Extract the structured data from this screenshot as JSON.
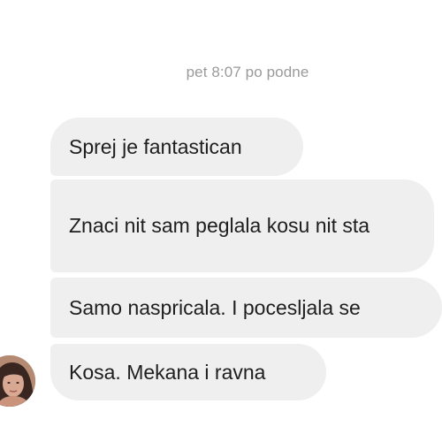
{
  "conversation": {
    "timestamp": "pet 8:07 po podne",
    "messages": [
      {
        "text": "Sprej je fantastican"
      },
      {
        "text": "Znaci nit sam peglala kosu nit sta"
      },
      {
        "text": "Samo naspricala. I pocesljala se"
      },
      {
        "text": "Kosa. Mekana i ravna"
      }
    ]
  },
  "avatar": {
    "icon": "profile-photo",
    "colors": {
      "skin": "#d9a892",
      "hair": "#3a2620",
      "background": "#b58a73"
    }
  }
}
